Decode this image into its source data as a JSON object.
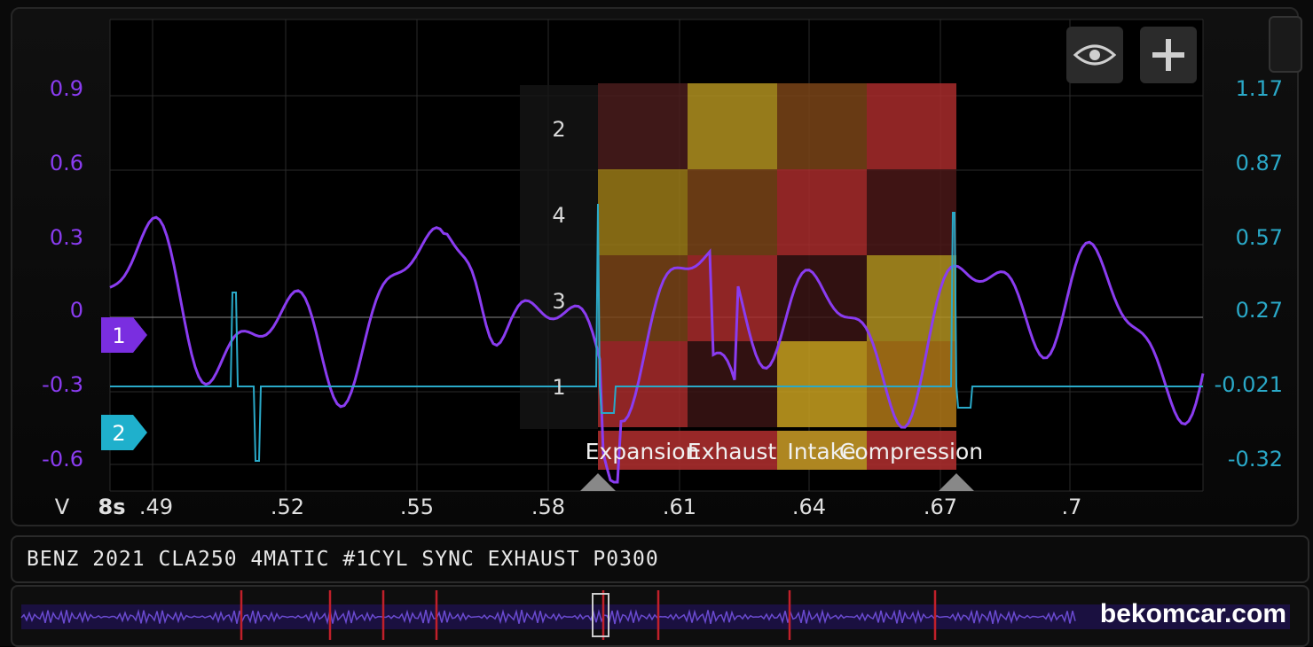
{
  "left_axis": {
    "unit": "V",
    "labels": [
      "0.9",
      "0.6",
      "0.3",
      "0",
      "-0.3",
      "-0.6"
    ],
    "color": "#8a3cf0"
  },
  "right_axis": {
    "labels": [
      "1.17",
      "0.87",
      "0.57",
      "0.27",
      "-0.021",
      "-0.32"
    ],
    "color": "#2aa9c8"
  },
  "x_axis": {
    "time_base": "8s",
    "labels": [
      ".49",
      ".52",
      ".55",
      ".58",
      ".61",
      ".64",
      ".67",
      ".7"
    ]
  },
  "channels": [
    {
      "label": "1",
      "color": "#7a2ee0"
    },
    {
      "label": "2",
      "color": "#1fb0cc"
    }
  ],
  "cylinder_rows": [
    "2",
    "4",
    "3",
    "1"
  ],
  "strokes": [
    "Expansion",
    "Exhaust",
    "Intake",
    "Compression"
  ],
  "controls": {
    "eye_icon": "eye-icon",
    "add_icon": "plus-icon"
  },
  "title": "BENZ 2021 CLA250 4MATIC #1CYL SYNC EXHAUST P0300",
  "watermark": "bekomcar.com",
  "colors": {
    "purple": "#8a3cf0",
    "cyan": "#2aa9c8",
    "red_cell": "#b0282c",
    "yellow_cell": "#c8a020"
  }
}
